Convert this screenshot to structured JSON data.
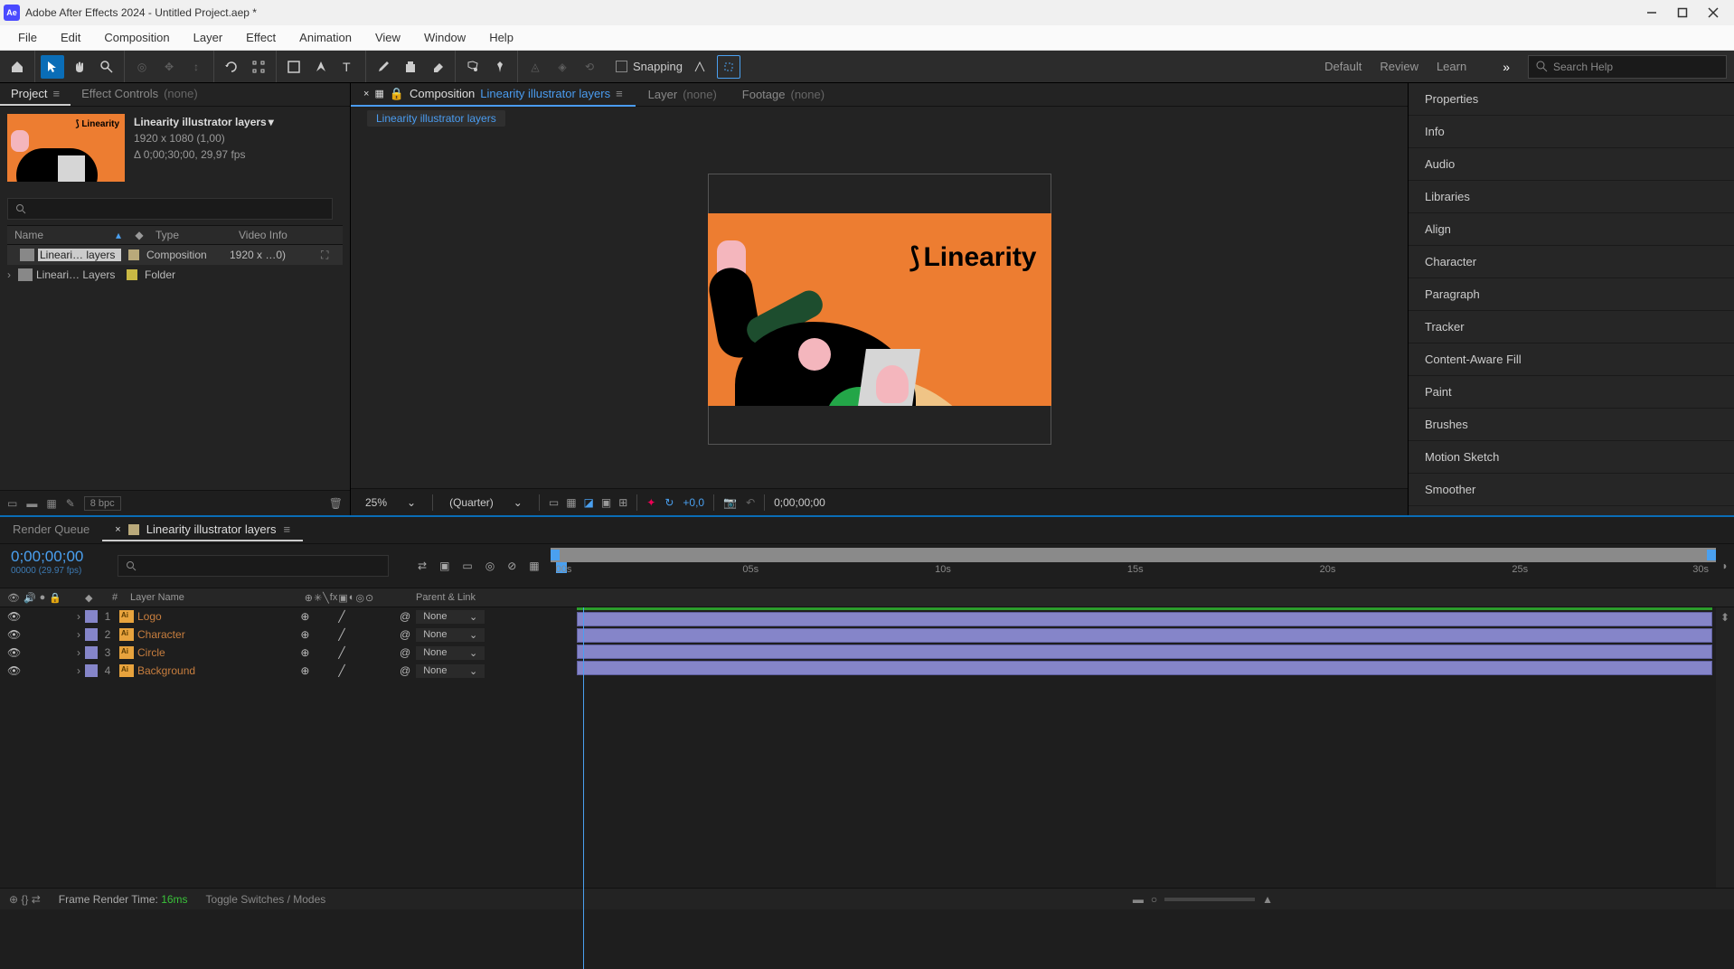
{
  "titlebar": {
    "app_icon": "Ae",
    "title": "Adobe After Effects 2024 - Untitled Project.aep *"
  },
  "menu": [
    "File",
    "Edit",
    "Composition",
    "Layer",
    "Effect",
    "Animation",
    "View",
    "Window",
    "Help"
  ],
  "toolbar": {
    "snapping_label": "Snapping"
  },
  "workspaces": [
    "Default",
    "Review",
    "Learn"
  ],
  "search": {
    "placeholder": "Search Help"
  },
  "project": {
    "tabs": {
      "project": "Project",
      "ec_label": "Effect Controls",
      "ec_target": "(none)"
    },
    "item": {
      "name": "Linearity illustrator layers",
      "dims": "1920 x 1080 (1,00)",
      "dur": "Δ 0;00;30;00, 29,97 fps"
    },
    "cols": {
      "name": "Name",
      "type": "Type",
      "vi": "Video Info"
    },
    "rows": [
      {
        "name": "Lineari… layers",
        "tag": "#b9a97a",
        "type": "Composition",
        "vi": "1920 x …0)",
        "selected": true,
        "hasFlow": true
      },
      {
        "name": "Lineari… Layers",
        "tag": "#c9b844",
        "type": "Folder",
        "vi": "",
        "selected": false,
        "twisty": true
      }
    ],
    "footer": {
      "bpc": "8 bpc"
    }
  },
  "composition": {
    "tabs": {
      "comp_label": "Composition",
      "comp_name": "Linearity illustrator layers",
      "layer_label": "Layer",
      "layer_target": "(none)",
      "footage_label": "Footage",
      "footage_target": "(none)"
    },
    "breadcrumb": "Linearity illustrator layers",
    "logo_text": "Linearity",
    "footer": {
      "zoom": "25%",
      "quality": "(Quarter)",
      "exposure": "+0,0",
      "time": "0;00;00;00"
    }
  },
  "right_panel": [
    "Properties",
    "Info",
    "Audio",
    "Libraries",
    "Align",
    "Character",
    "Paragraph",
    "Tracker",
    "Content-Aware Fill",
    "Paint",
    "Brushes",
    "Motion Sketch",
    "Smoother"
  ],
  "timeline": {
    "tabs": {
      "rq": "Render Queue",
      "active": "Linearity illustrator layers"
    },
    "time": "0;00;00;00",
    "subtime": "00000 (29.97 fps)",
    "ruler": [
      "00s",
      "05s",
      "10s",
      "15s",
      "20s",
      "25s",
      "30s"
    ],
    "cols": {
      "num": "#",
      "lname": "Layer Name",
      "parent": "Parent & Link"
    },
    "rows": [
      {
        "num": "1",
        "name": "Logo",
        "parent": "None"
      },
      {
        "num": "2",
        "name": "Character",
        "parent": "None"
      },
      {
        "num": "3",
        "name": "Circle",
        "parent": "None"
      },
      {
        "num": "4",
        "name": "Background",
        "parent": "None"
      }
    ],
    "footer": {
      "frt_label": "Frame Render Time:",
      "frt_value": "16ms",
      "toggle": "Toggle Switches / Modes"
    }
  }
}
